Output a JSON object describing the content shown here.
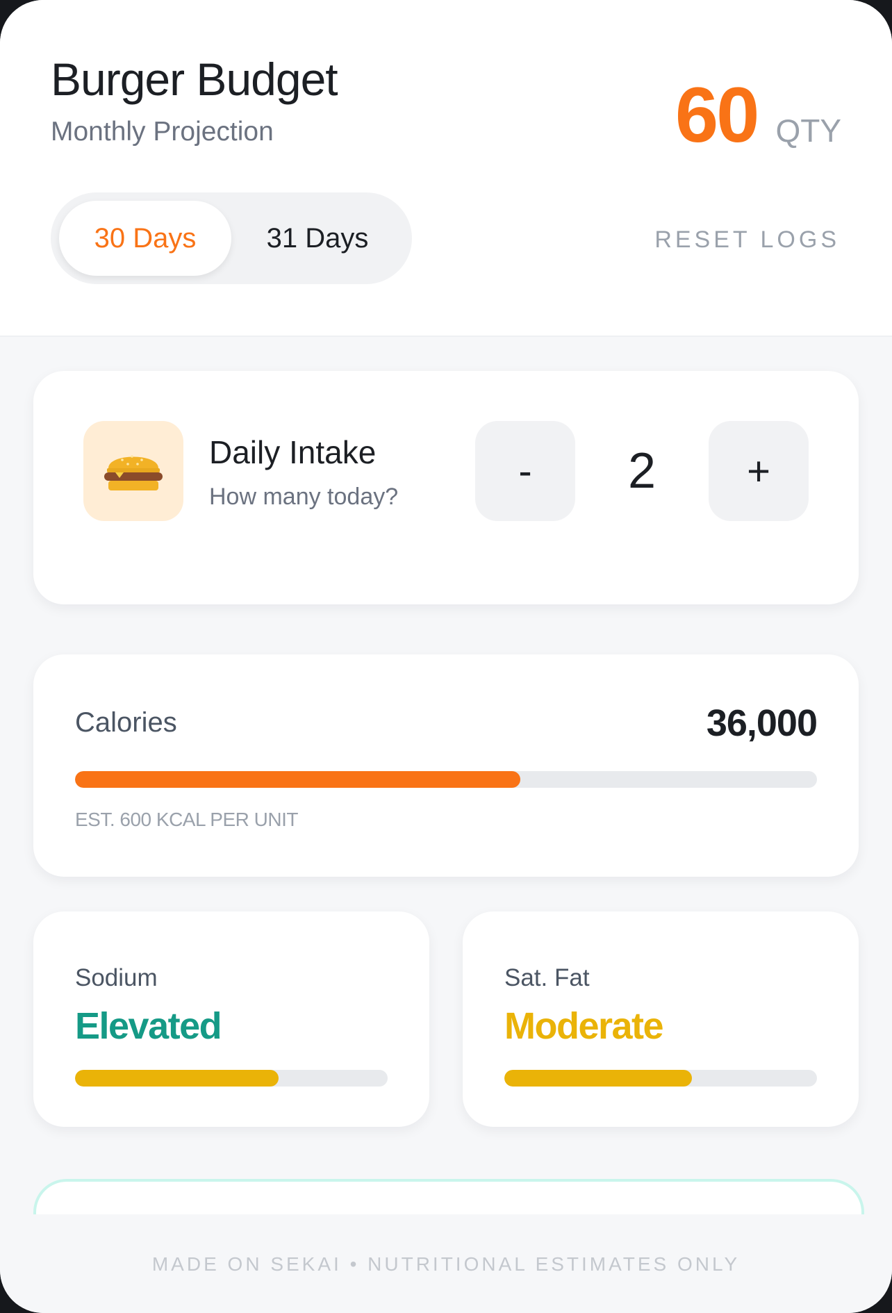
{
  "header": {
    "title": "Burger Budget",
    "subtitle": "Monthly Projection",
    "quantity": "60",
    "quantity_unit": "QTY",
    "period_options": [
      "30 Days",
      "31 Days"
    ],
    "selected_period": "30 Days",
    "reset_label": "RESET LOGS"
  },
  "intake": {
    "icon": "burger-icon",
    "title": "Daily Intake",
    "subtitle": "How many today?",
    "decrement_label": "-",
    "value": "2",
    "increment_label": "+"
  },
  "calories": {
    "label": "Calories",
    "value": "36,000",
    "progress_fraction": 0.6,
    "note": "EST. 600 KCAL PER UNIT"
  },
  "metrics": [
    {
      "label": "Sodium",
      "status": "Elevated",
      "status_color": "#159a86",
      "bar_color": "#eab308",
      "progress_fraction": 0.65
    },
    {
      "label": "Sat. Fat",
      "status": "Moderate",
      "status_color": "#eab308",
      "bar_color": "#eab308",
      "progress_fraction": 0.6
    }
  ],
  "footer": {
    "text": "MADE ON SEKAI • NUTRITIONAL ESTIMATES ONLY"
  },
  "colors": {
    "accent": "#f97316",
    "calorie_bar": "#f97316",
    "track": "#e8eaed"
  }
}
